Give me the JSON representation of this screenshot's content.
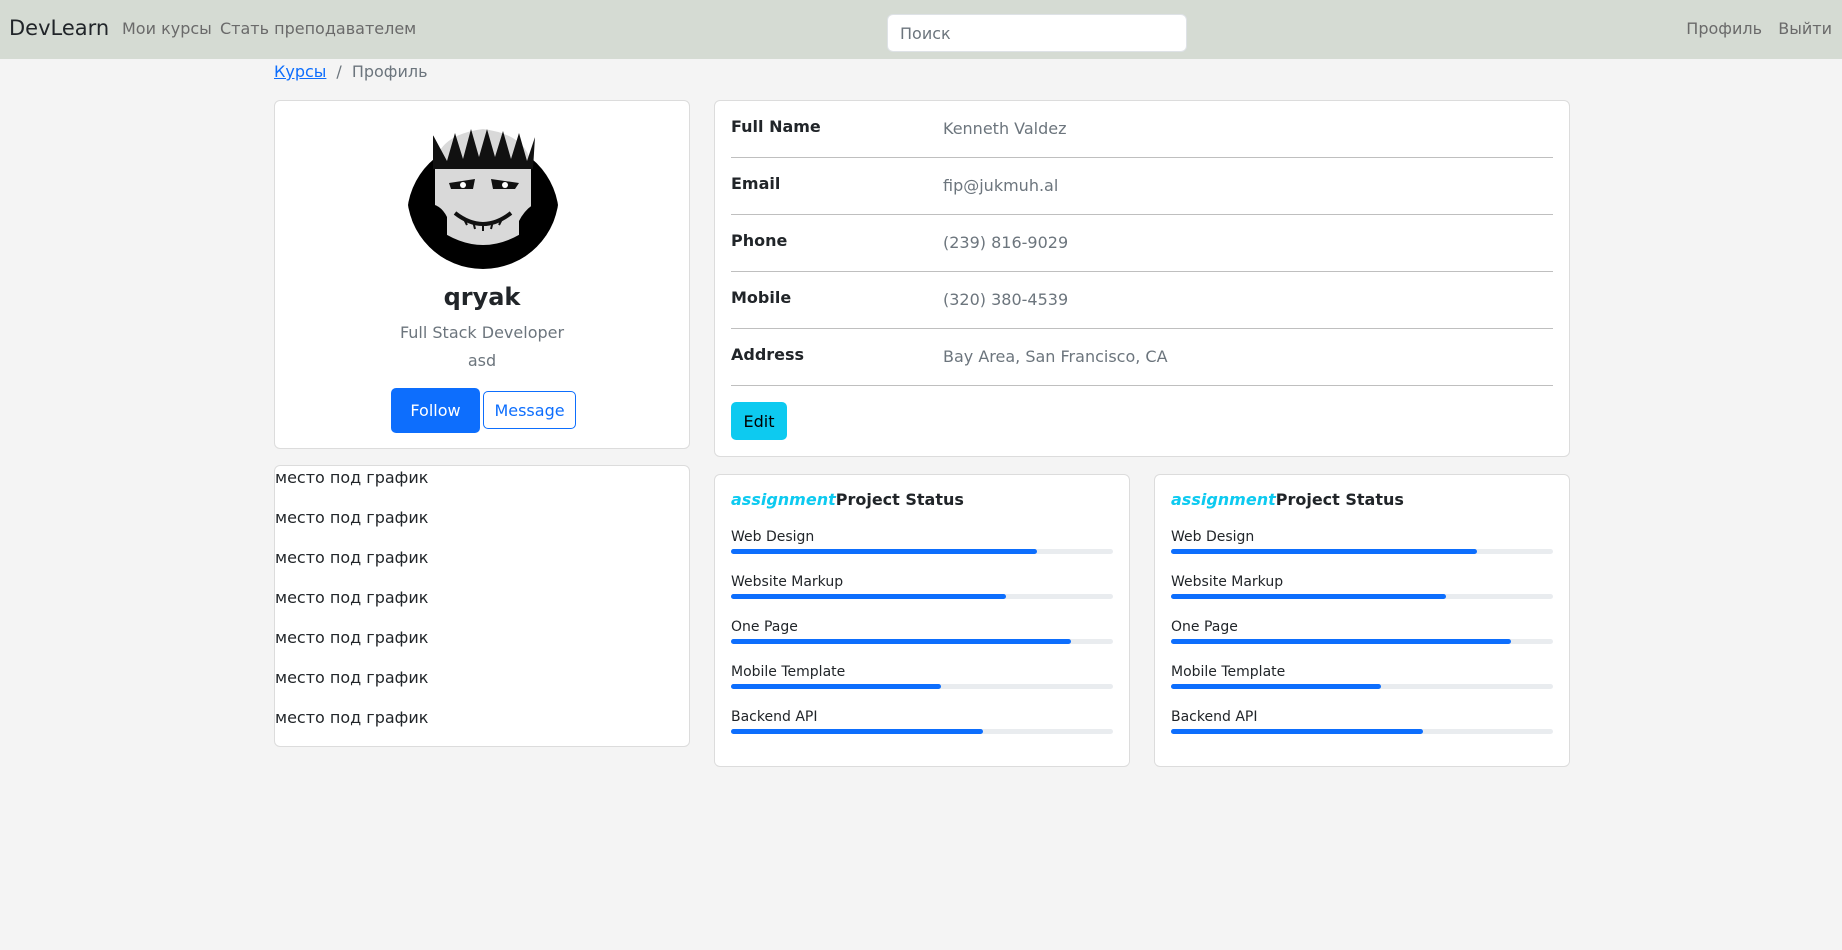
{
  "navbar": {
    "brand": "DevLearn",
    "links": [
      "Мои курсы",
      "Стать преподавателем"
    ],
    "search_placeholder": "Поиск",
    "profile": "Профиль",
    "logout": "Выйти"
  },
  "breadcrumb": {
    "parent": "Курсы",
    "separator": "/",
    "current": "Профиль"
  },
  "profile": {
    "username": "qryak",
    "role": "Full Stack Developer",
    "extra": "asd",
    "follow_label": "Follow",
    "message_label": "Message"
  },
  "chart_placeholder": [
    "место под график",
    "место под график",
    "место под график",
    "место под график",
    "место под график",
    "место под график",
    "место под график"
  ],
  "info": {
    "rows": [
      {
        "label": "Full Name",
        "value": "Kenneth Valdez"
      },
      {
        "label": "Email",
        "value": "fip@jukmuh.al"
      },
      {
        "label": "Phone",
        "value": "(239) 816-9029"
      },
      {
        "label": "Mobile",
        "value": "(320) 380-4539"
      },
      {
        "label": "Address",
        "value": "Bay Area, San Francisco, CA"
      }
    ],
    "edit_label": "Edit"
  },
  "status_cards": [
    {
      "accent": "assignment",
      "title": "Project Status",
      "items": [
        {
          "label": "Web Design",
          "percent": 80
        },
        {
          "label": "Website Markup",
          "percent": 72
        },
        {
          "label": "One Page",
          "percent": 89
        },
        {
          "label": "Mobile Template",
          "percent": 55
        },
        {
          "label": "Backend API",
          "percent": 66
        }
      ]
    },
    {
      "accent": "assignment",
      "title": "Project Status",
      "items": [
        {
          "label": "Web Design",
          "percent": 80
        },
        {
          "label": "Website Markup",
          "percent": 72
        },
        {
          "label": "One Page",
          "percent": 89
        },
        {
          "label": "Mobile Template",
          "percent": 55
        },
        {
          "label": "Backend API",
          "percent": 66
        }
      ]
    }
  ],
  "colors": {
    "primary": "#0d6efd",
    "info": "#0dcaf0",
    "navbar_bg": "#d5dbd3"
  }
}
